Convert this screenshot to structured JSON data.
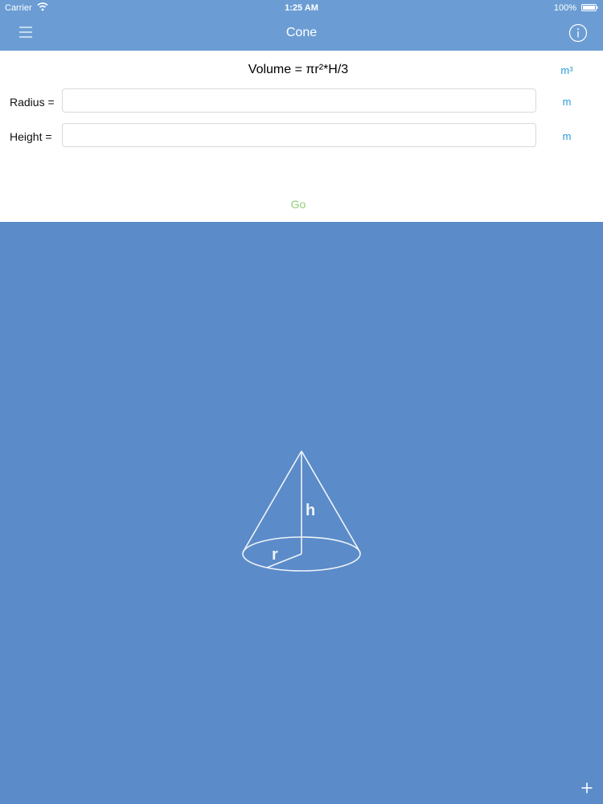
{
  "status_bar": {
    "carrier": "Carrier",
    "time": "1:25 AM",
    "battery": "100%"
  },
  "nav": {
    "title": "Cone",
    "menu_icon": "hamburger-menu-icon",
    "info_icon": "info-icon"
  },
  "form": {
    "formula": "Volume = πr²*H/3",
    "volume_unit": "m³",
    "radius": {
      "label": "Radius =",
      "value": "",
      "unit": "m"
    },
    "height": {
      "label": "Height =",
      "value": "",
      "unit": "m"
    },
    "go_label": "Go"
  },
  "diagram": {
    "height_label": "h",
    "radius_label": "r"
  },
  "footer": {
    "add_icon": "plus-icon"
  },
  "colors": {
    "nav_background": "#6b9dd4",
    "content_background": "#5b8bc9",
    "unit_accent": "#2a9bd6",
    "go_accent": "#8fce79"
  }
}
